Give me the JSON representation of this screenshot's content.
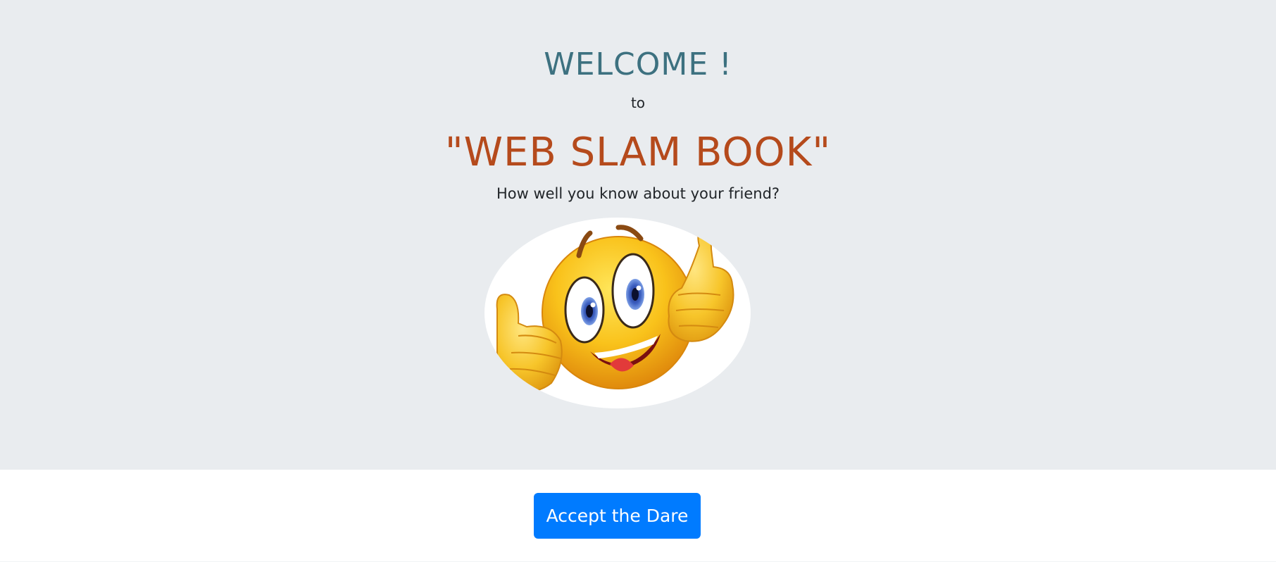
{
  "hero": {
    "welcome": "WELCOME !",
    "to": "to",
    "title": "\"WEB SLAM BOOK\"",
    "subtitle": "How well you know about your friend?",
    "image_icon": "thumbs-up-smiley-emoji"
  },
  "cta": {
    "label": "Accept the Dare"
  },
  "colors": {
    "hero_bg": "#e9ecef",
    "welcome": "#3d7180",
    "title": "#b54a1c",
    "button": "#007bff"
  }
}
